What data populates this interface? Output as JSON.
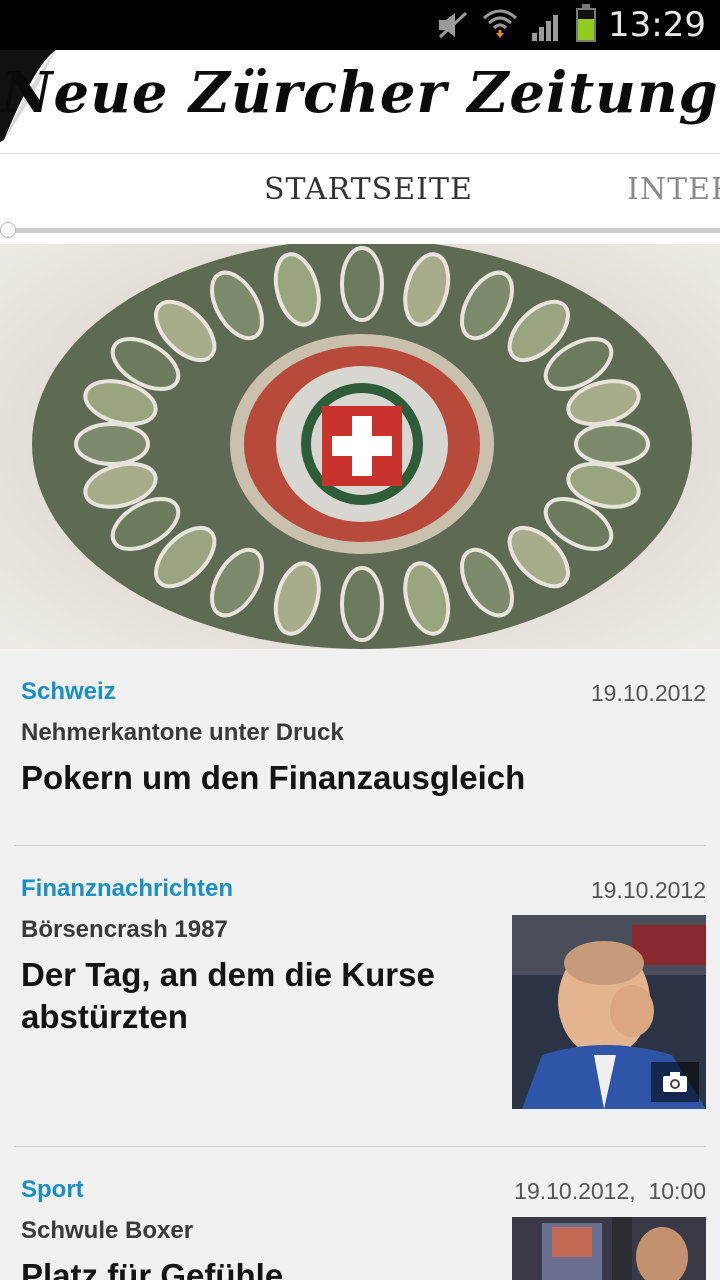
{
  "status_bar": {
    "time": "13:29",
    "battery_level": 0.7,
    "icons": [
      "mute-icon",
      "wifi-icon",
      "signal-icon",
      "battery-icon"
    ]
  },
  "masthead": {
    "logo": "Neue Zürcher Zeitung"
  },
  "tabs": [
    {
      "label": "STARTSEITE",
      "active": true
    },
    {
      "label": "INTER"
    }
  ],
  "articles": [
    {
      "category": "Schweiz",
      "date": "19.10.2012",
      "kicker": "Nehmerkantone unter Druck",
      "title": "Pokern um den Finanzausgleich"
    },
    {
      "category": "Finanznachrichten",
      "date": "19.10.2012",
      "kicker": "Börsencrash 1987",
      "title": "Der Tag, an dem die Kurse abstürzten"
    },
    {
      "category": "Sport",
      "date": "19.10.2012,  10:00",
      "kicker": "Schwule Boxer",
      "title": "Platz für Gefühle"
    }
  ],
  "colors": {
    "category": "#1a8fc4",
    "battery": "#8fcc1e"
  }
}
